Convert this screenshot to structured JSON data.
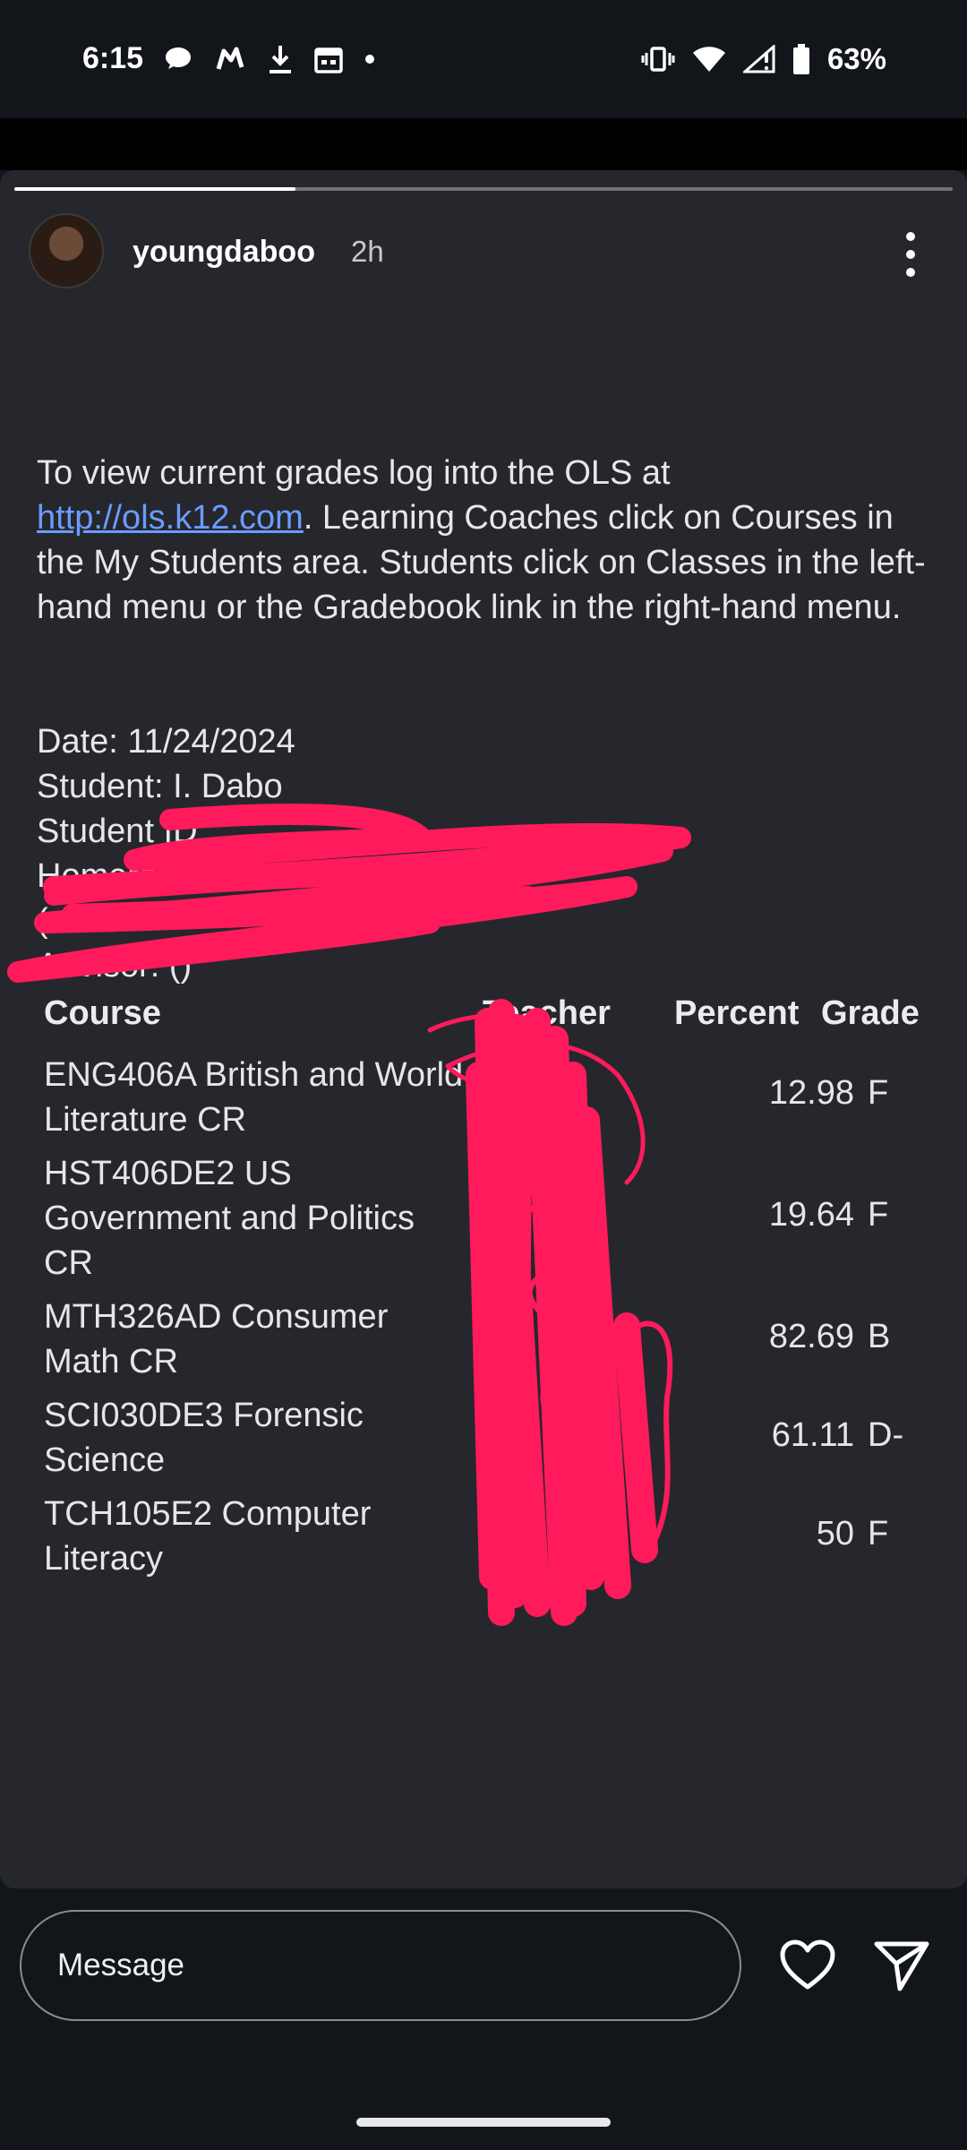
{
  "status_bar": {
    "time": "6:15",
    "battery_text": "63%",
    "left_icons": [
      "chat-bubble-icon",
      "messenger-icon",
      "download-icon",
      "calendar-icon",
      "dot-icon"
    ],
    "right_icons": [
      "vibrate-icon",
      "wifi-icon",
      "signal-icon",
      "battery-icon"
    ]
  },
  "story": {
    "progress": 0.3,
    "username": "youngdaboo",
    "time_ago": "2h",
    "intro": {
      "pre_link": "To view current grades log into the OLS at ",
      "link": "http://ols.k12.com",
      "post_link": ". Learning Coaches click on Courses in the My Students area. Students click on Classes in the left-hand menu or the Gradebook link in the right-hand menu."
    },
    "info": {
      "date": "Date: 11/24/2024",
      "student": "Student: I. Dabo",
      "student_id": "Student ID",
      "homeroom": "Homeroom Teacher:",
      "homeroom_email": "(",
      "advisor": "Advisor: ()"
    },
    "table": {
      "headers": [
        "Course",
        "Teacher",
        "Percent",
        "Grade"
      ],
      "rows": [
        {
          "course": "ENG406A British and World Literature CR",
          "percent": "12.98",
          "grade": "F"
        },
        {
          "course": "HST406DE2 US Government and Politics CR",
          "percent": "19.64",
          "grade": "F"
        },
        {
          "course": "MTH326AD Consumer Math CR",
          "percent": "82.69",
          "grade": "B"
        },
        {
          "course": "SCI030DE3 Forensic Science",
          "percent": "61.11",
          "grade": "D-"
        },
        {
          "course": "TCH105E2 Computer Literacy",
          "percent": "50",
          "grade": "F"
        }
      ]
    }
  },
  "footer": {
    "message_placeholder": "Message"
  },
  "colors": {
    "link": "#6c9bff",
    "scribble": "#ff1a5c",
    "card_bg": "#25272c"
  }
}
